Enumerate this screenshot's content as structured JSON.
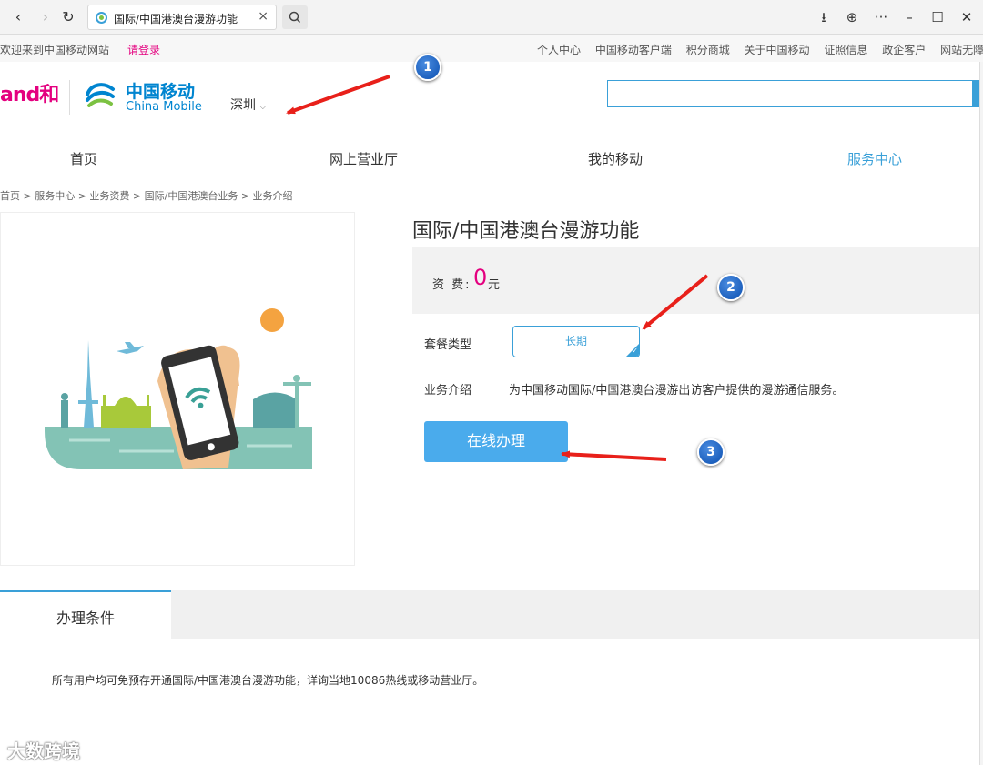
{
  "browser": {
    "tab_title": "国际/中国港澳台漫游功能",
    "tab_close": "×",
    "back": "‹",
    "forward": "›",
    "reload": "↻",
    "download": "⭳",
    "globe": "⊕",
    "more": "···",
    "minimize": "–",
    "maximize": "☐",
    "close": "✕"
  },
  "top_bar": {
    "welcome": "欢迎来到中国移动网站",
    "login": "请登录",
    "links": [
      "个人中心",
      "中国移动客户端",
      "积分商城",
      "关于中国移动",
      "证照信息",
      "政企客户",
      "网站无障碍"
    ]
  },
  "header": {
    "and_logo": "and和",
    "cm_cn": "中国移动",
    "cm_en": "China Mobile",
    "city": "深圳",
    "city_arrow": "⌵"
  },
  "main_nav": {
    "items": [
      "首页",
      "网上营业厅",
      "我的移动",
      "服务中心"
    ],
    "active_index": 3
  },
  "breadcrumb": "首页 > 服务中心 > 业务资费 > 国际/中国港澳台业务 > 业务介绍",
  "product": {
    "title": "国际/中国港澳台漫游功能",
    "price_label": "资 费:",
    "price_value": "0",
    "price_unit": "元",
    "package_label": "套餐类型",
    "package_option": "长期",
    "intro_label": "业务介绍",
    "intro_text": "为中国移动国际/中国港澳台漫游出访客户提供的漫游通信服务。",
    "apply_button": "在线办理"
  },
  "conditions": {
    "tab_label": "办理条件",
    "text": "所有用户均可免预存开通国际/中国港澳台漫游功能，详询当地10086热线或移动营业厅。"
  },
  "annotations": {
    "badges": [
      "1",
      "2",
      "3"
    ],
    "arrow_color": "#e8201a"
  },
  "watermark": "大数跨境",
  "colors": {
    "brand_blue": "#3aa0d8",
    "brand_pink": "#e4007f",
    "button_blue": "#4aabec"
  }
}
